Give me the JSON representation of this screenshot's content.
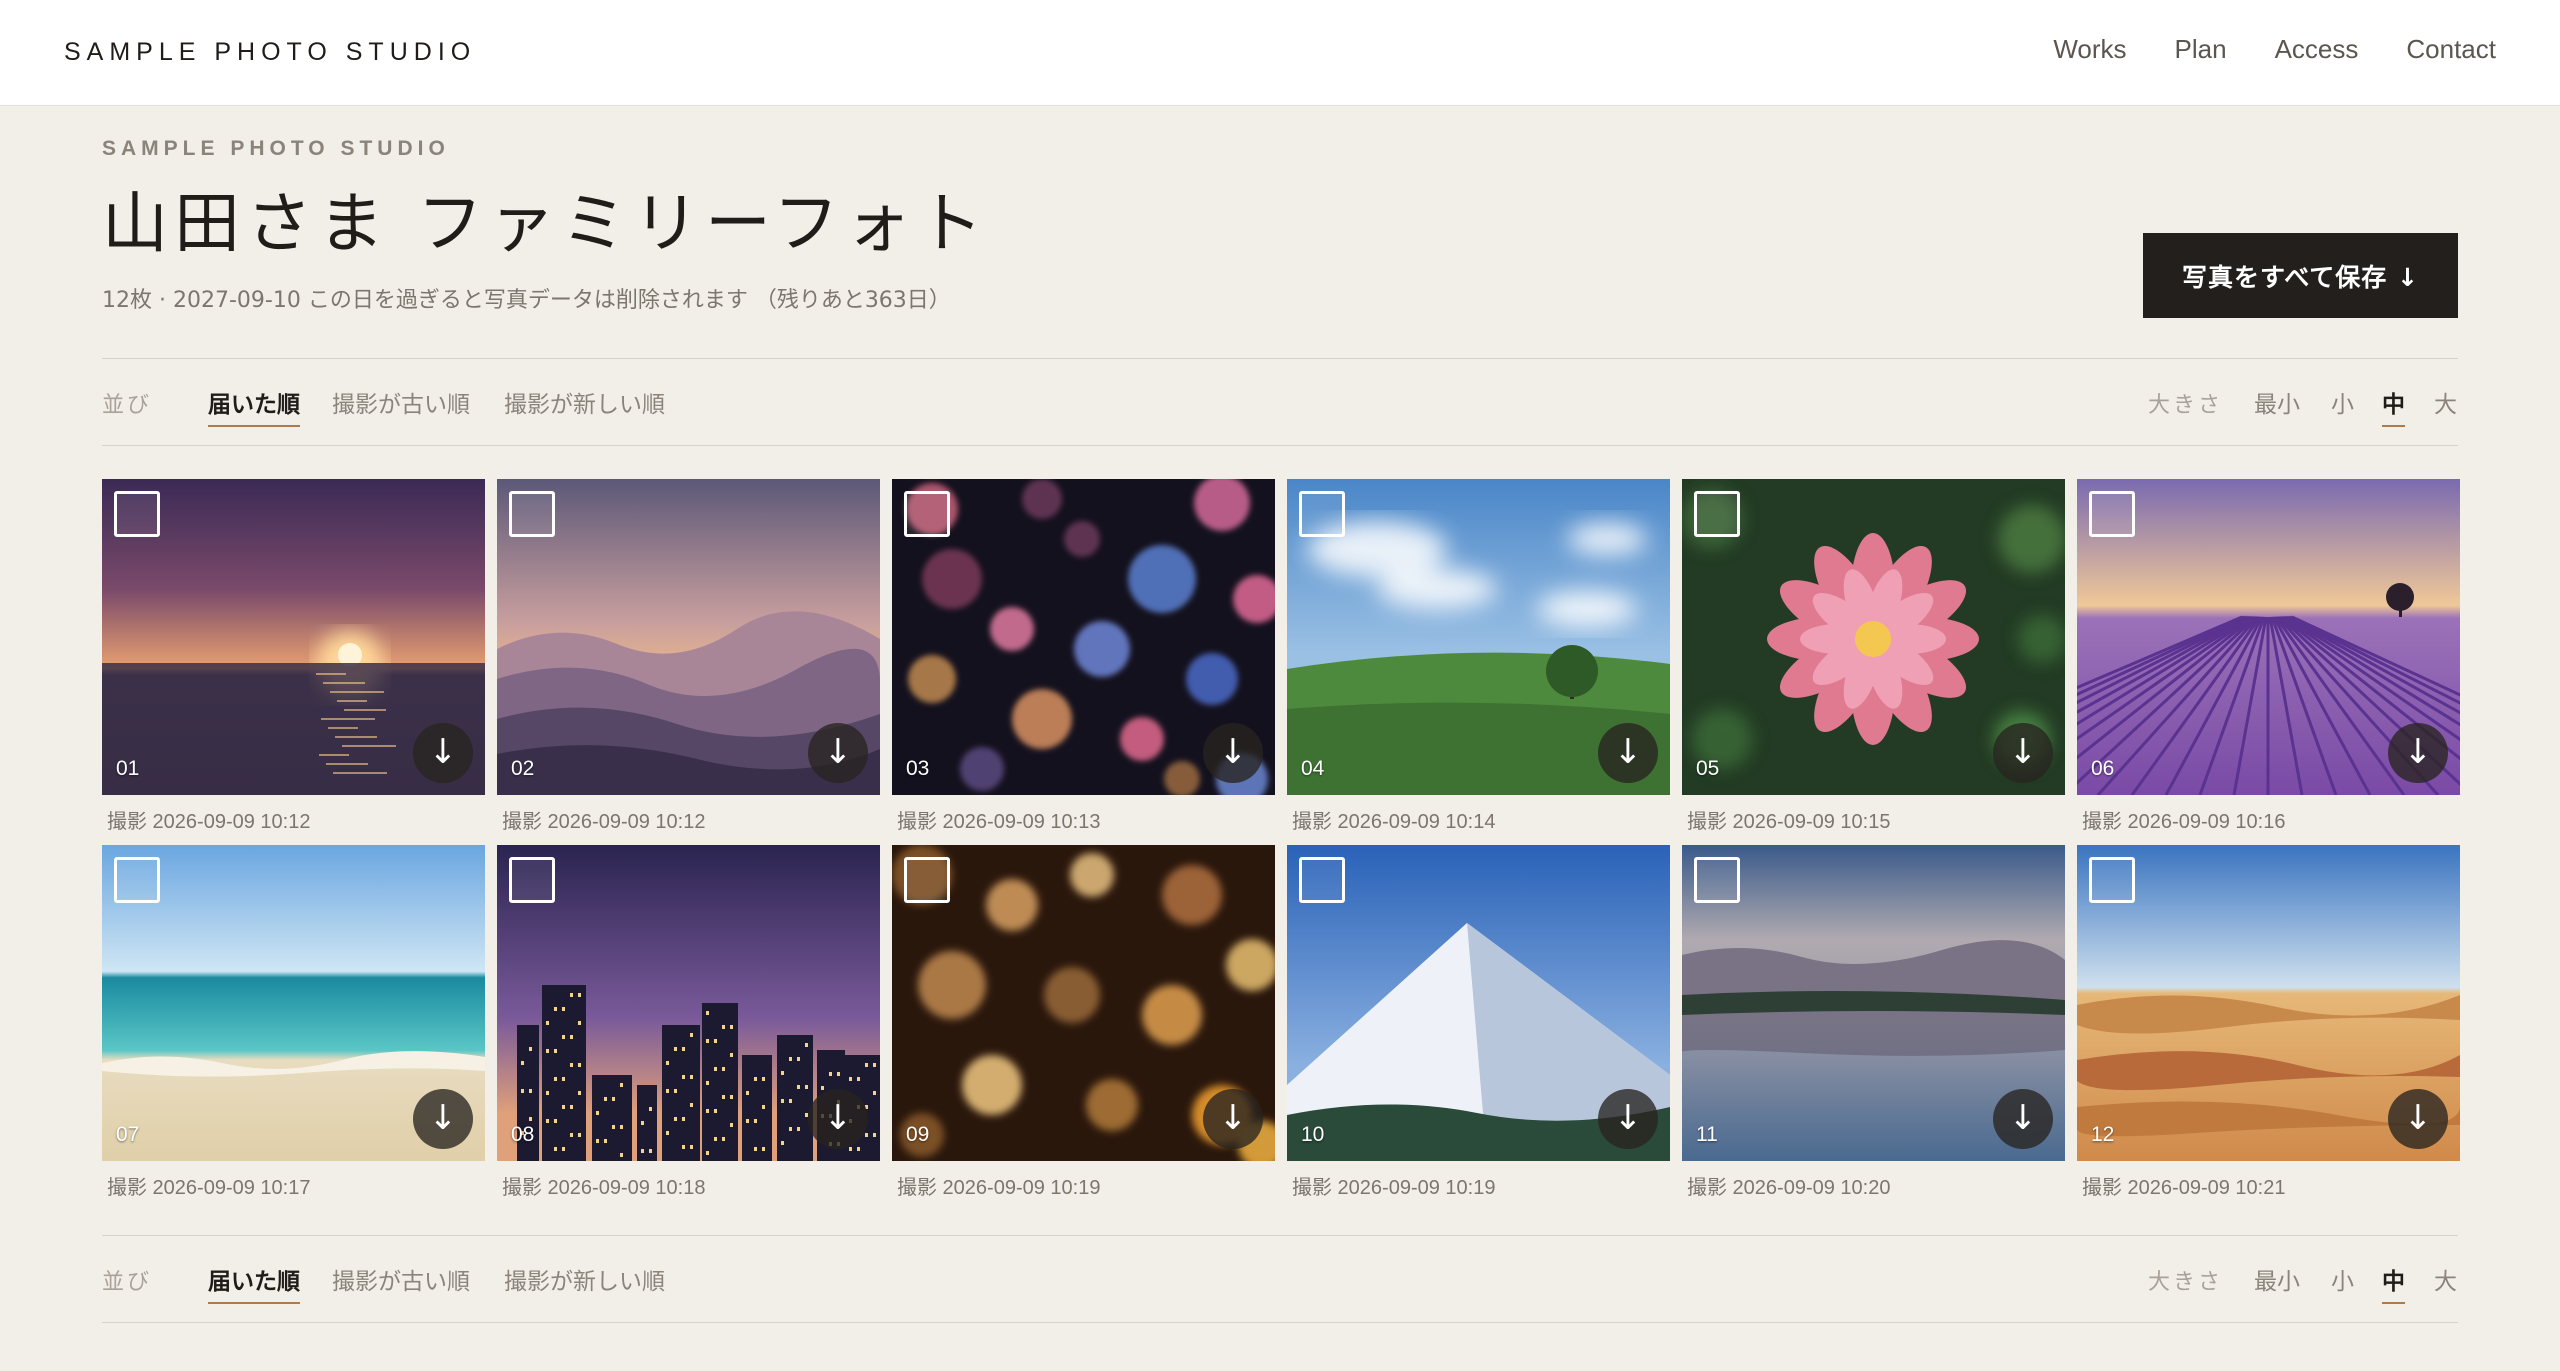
{
  "header": {
    "brand": "SAMPLE PHOTO STUDIO",
    "nav": [
      "Works",
      "Plan",
      "Access",
      "Contact"
    ]
  },
  "album": {
    "eyebrow": "SAMPLE PHOTO STUDIO",
    "title": "山田さま ファミリーフォト",
    "meta": "12枚 · 2027-09-10 この日を過ぎると写真データは削除されます （残りあと363日）",
    "save_all_label": "写真をすべて保存 ↓"
  },
  "toolbar": {
    "sort_label": "並び",
    "sort_options": [
      "届いた順",
      "撮影が古い順",
      "撮影が新しい順"
    ],
    "sort_active": "届いた順",
    "size_label": "大きさ",
    "size_options": [
      "最小",
      "小",
      "中",
      "大"
    ],
    "size_active": "中"
  },
  "photos": [
    {
      "number": "01",
      "caption": "撮影 2026-09-09 10:12",
      "scene": "sunset-sea"
    },
    {
      "number": "02",
      "caption": "撮影 2026-09-09 10:12",
      "scene": "misty-mountains"
    },
    {
      "number": "03",
      "caption": "撮影 2026-09-09 10:13",
      "scene": "night-bokeh"
    },
    {
      "number": "04",
      "caption": "撮影 2026-09-09 10:14",
      "scene": "green-hill-tree"
    },
    {
      "number": "05",
      "caption": "撮影 2026-09-09 10:15",
      "scene": "pink-flower"
    },
    {
      "number": "06",
      "caption": "撮影 2026-09-09 10:16",
      "scene": "lavender-field"
    },
    {
      "number": "07",
      "caption": "撮影 2026-09-09 10:17",
      "scene": "beach"
    },
    {
      "number": "08",
      "caption": "撮影 2026-09-09 10:18",
      "scene": "city-night"
    },
    {
      "number": "09",
      "caption": "撮影 2026-09-09 10:19",
      "scene": "warm-bokeh"
    },
    {
      "number": "10",
      "caption": "撮影 2026-09-09 10:19",
      "scene": "snow-mountain"
    },
    {
      "number": "11",
      "caption": "撮影 2026-09-09 10:20",
      "scene": "lake-reflection"
    },
    {
      "number": "12",
      "caption": "撮影 2026-09-09 10:21",
      "scene": "desert-dunes"
    }
  ],
  "icons": {
    "download": "↓"
  },
  "colors": {
    "accent": "#b07b4a",
    "button_dark": "#221f1c",
    "background": "#f2efe9"
  }
}
